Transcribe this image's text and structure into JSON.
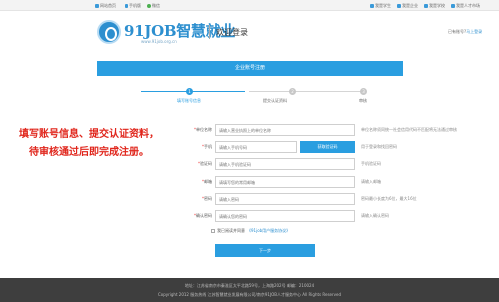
{
  "topbar": {
    "left_items": [
      "网站首页",
      "手机版",
      "微信"
    ],
    "right_items": [
      "我是学生",
      "我是企业",
      "我是学校",
      "我是人才市场"
    ],
    "colors": {
      "home": "#3a9ad9",
      "mobile": "#3a9ad9",
      "wechat": "#4caf50",
      "student": "#3a9ad9",
      "company": "#3a9ad9",
      "school": "#3a9ad9",
      "talent": "#3a9ad9"
    }
  },
  "header": {
    "logo_text": "91JOB智慧就业",
    "logo_url": "www.91job.org.cn",
    "page_title": "欢迎登录",
    "have_account_prefix": "已有账号?",
    "login_link": "马上登录"
  },
  "form_title": "企业账号注册",
  "steps": [
    {
      "number": "1",
      "label": "填写账号信息",
      "active": true
    },
    {
      "number": "2",
      "label": "提交认证资料",
      "active": false
    },
    {
      "number": "3",
      "label": "审核",
      "active": false
    }
  ],
  "side_note": [
    "填写账号信息、提交认证资料，",
    "待审核通过后即完成注册。"
  ],
  "fields": [
    {
      "label": "单位名称",
      "placeholder": "请输入营业执照上的单位名称",
      "hint": "单位名称须同统一社会信用代码不匹配将无法通过审核"
    },
    {
      "label": "手机",
      "placeholder": "请输入手机号码",
      "button": "获取验证码",
      "hint": "用于登录和找回密码"
    },
    {
      "label": "验证码",
      "placeholder": "请输入手机验证码",
      "hint": "手机验证码"
    },
    {
      "label": "邮箱",
      "placeholder": "请填写您的常用邮箱",
      "hint": "请输入邮箱"
    },
    {
      "label": "密码",
      "placeholder": "请输入密码",
      "hint": "密码最小长度为6位，最大16位"
    },
    {
      "label": "确认密码",
      "placeholder": "请确认您的密码",
      "hint": "请输入确认密码"
    }
  ],
  "agreement": {
    "prefix": "我已阅读并同意",
    "link": "《91job用户服务协议》"
  },
  "next_button": "下一步",
  "footer": {
    "line1": "地址：江苏省南京市秦淮区太平北路59号，上海路202号  邮编：210024",
    "line2": "Copyright 2012 服务热线 江苏智慧就业发展有限公司/南京91JOB人才服务中心 All Rights Reserved"
  },
  "accent_color": "#2a9ee0",
  "note_color": "#e0251b"
}
